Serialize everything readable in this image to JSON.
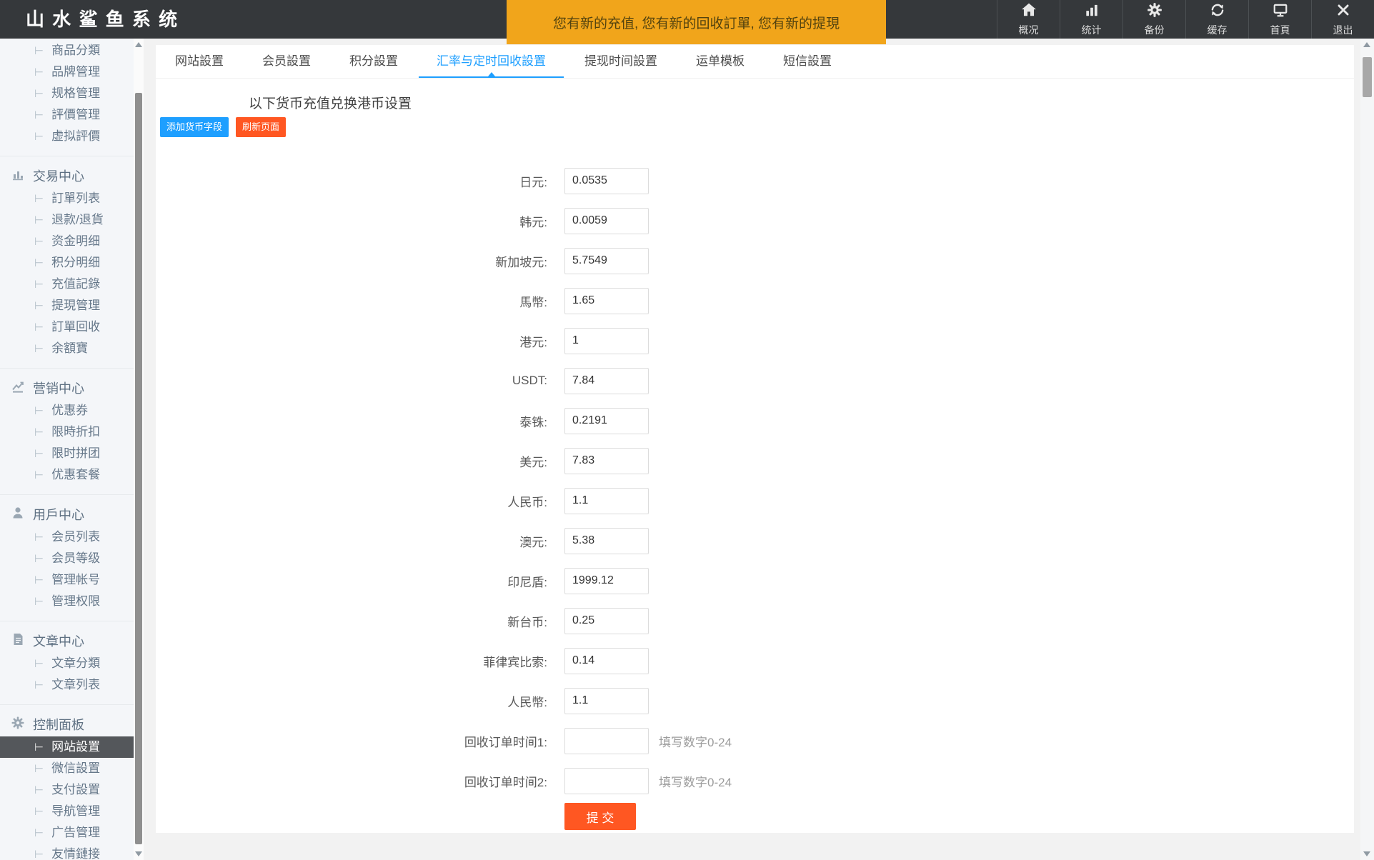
{
  "app": {
    "title": "山 水 鲨 鱼 系 统"
  },
  "colors": {
    "accent": "#1E9FFF",
    "orange": "#FF5722",
    "banner_bg": "#F1A51B",
    "header_bg": "#35383b",
    "selected_item_bg": "#54575b"
  },
  "header": {
    "notice": "您有新的充值, 您有新的回收訂單, 您有新的提現",
    "nav": [
      {
        "icon": "home-icon",
        "label": "概况"
      },
      {
        "icon": "stats-icon",
        "label": "统计"
      },
      {
        "icon": "backup-gear-icon",
        "label": "备份"
      },
      {
        "icon": "cache-refresh-icon",
        "label": "缓存"
      },
      {
        "icon": "homepage-monitor-icon",
        "label": "首頁"
      },
      {
        "icon": "logout-x-icon",
        "label": "退出"
      }
    ]
  },
  "sidebar": {
    "sections": [
      {
        "items": [
          {
            "label": "商品分類"
          },
          {
            "label": "品牌管理"
          },
          {
            "label": "规格管理"
          },
          {
            "label": "評價管理"
          },
          {
            "label": "虚拟評價"
          }
        ]
      },
      {
        "header": "交易中心",
        "icon": "chart-bar-icon",
        "items": [
          {
            "label": "訂單列表"
          },
          {
            "label": "退款/退貨"
          },
          {
            "label": "资金明细"
          },
          {
            "label": "积分明细"
          },
          {
            "label": "充值記錄"
          },
          {
            "label": "提現管理"
          },
          {
            "label": "訂單回收"
          },
          {
            "label": "余額寶"
          }
        ]
      },
      {
        "header": "营销中心",
        "icon": "chart-trend-icon",
        "items": [
          {
            "label": "优惠券"
          },
          {
            "label": "限時折扣"
          },
          {
            "label": "限时拼团"
          },
          {
            "label": "优惠套餐"
          }
        ]
      },
      {
        "header": "用戶中心",
        "icon": "user-icon",
        "items": [
          {
            "label": "会员列表"
          },
          {
            "label": "会员等级"
          },
          {
            "label": "管理帐号"
          },
          {
            "label": "管理权限"
          }
        ]
      },
      {
        "header": "文章中心",
        "icon": "article-icon",
        "items": [
          {
            "label": "文章分類"
          },
          {
            "label": "文章列表"
          }
        ]
      },
      {
        "header": "控制面板",
        "icon": "gear-icon",
        "items": [
          {
            "label": "网站設置",
            "selected": true
          },
          {
            "label": "微信設置"
          },
          {
            "label": "支付設置"
          },
          {
            "label": "导航管理"
          },
          {
            "label": "广告管理"
          },
          {
            "label": "友情鏈接"
          }
        ]
      }
    ]
  },
  "tabs": [
    "网站設置",
    "会员設置",
    "积分設置",
    "汇率与定时回收設置",
    "提现时间設置",
    "运单模板",
    "短信設置"
  ],
  "active_tab_index": 3,
  "content": {
    "heading": "以下货币充值兑换港币设置",
    "buttons": {
      "add": "添加货币字段",
      "refresh": "刷新页面",
      "submit": "提 交"
    },
    "form": {
      "rows": [
        {
          "key": "jpy",
          "label": "日元:",
          "value": "0.0535"
        },
        {
          "key": "krw",
          "label": "韩元:",
          "value": "0.0059"
        },
        {
          "key": "sgd",
          "label": "新加坡元:",
          "value": "5.7549"
        },
        {
          "key": "myr",
          "label": "馬幣:",
          "value": "1.65"
        },
        {
          "key": "hkd",
          "label": "港元:",
          "value": "1"
        },
        {
          "key": "usdt",
          "label": "USDT:",
          "value": "7.84"
        },
        {
          "key": "thb",
          "label": "泰铢:",
          "value": "0.2191"
        },
        {
          "key": "usd",
          "label": "美元:",
          "value": "7.83"
        },
        {
          "key": "cny",
          "label": "人民币:",
          "value": "1.1"
        },
        {
          "key": "aud",
          "label": "澳元:",
          "value": "5.38"
        },
        {
          "key": "idr",
          "label": "印尼盾:",
          "value": "1999.12"
        },
        {
          "key": "twd",
          "label": "新台币:",
          "value": "0.25"
        },
        {
          "key": "php",
          "label": "菲律宾比索:",
          "value": "0.14"
        },
        {
          "key": "rmb",
          "label": "人民幣:",
          "value": "1.1"
        },
        {
          "key": "recycle-time-1",
          "label": "回收订单时间1:",
          "value": "",
          "hint": "填写数字0-24"
        },
        {
          "key": "recycle-time-2",
          "label": "回收订单时间2:",
          "value": "",
          "hint": "填写数字0-24"
        }
      ]
    }
  }
}
